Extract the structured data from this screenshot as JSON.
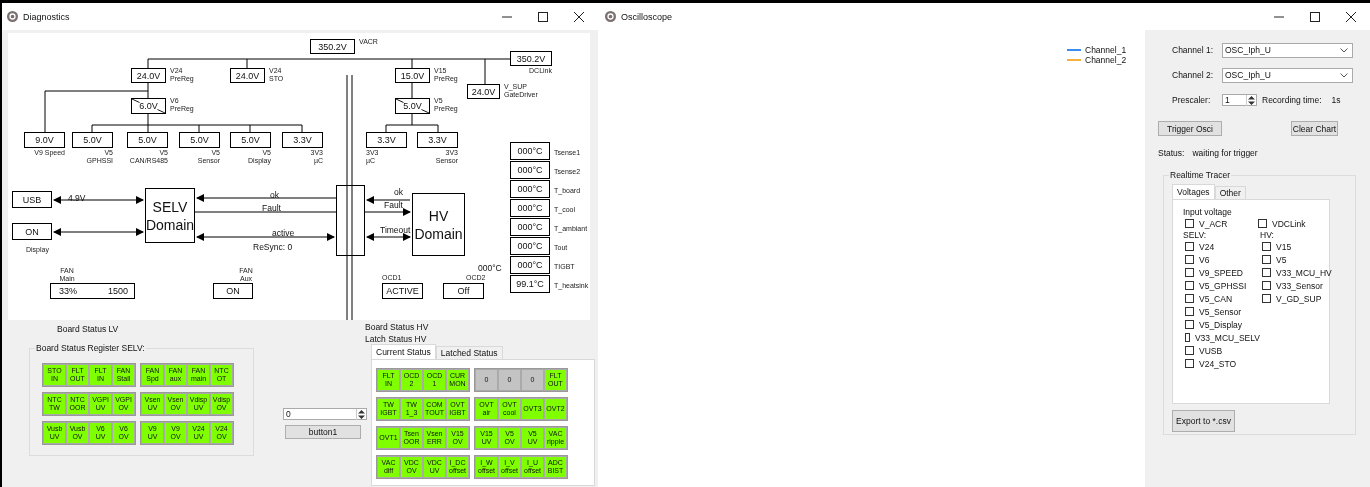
{
  "diagnostics": {
    "title": "Diagnostics",
    "diagram": {
      "voltages": [
        {
          "value": "350.2V",
          "label": "VACR",
          "kind": "reading"
        },
        {
          "value": "24.0V",
          "label": "V24\nPreReg",
          "kind": "reading"
        },
        {
          "value": "24.0V",
          "label": "V24\nSTO",
          "kind": "reading"
        },
        {
          "value": "6.0V",
          "label": "V6\nPreReg",
          "kind": "regulator"
        },
        {
          "value": "9.0V",
          "label": "V9 Speed",
          "kind": "reading"
        },
        {
          "value": "5.0V",
          "label": "V5\nGPHSSI",
          "kind": "reading"
        },
        {
          "value": "5.0V",
          "label": "V5\nCAN/RS485",
          "kind": "reading"
        },
        {
          "value": "5.0V",
          "label": "V5\nSensor",
          "kind": "reading"
        },
        {
          "value": "5.0V",
          "label": "V5\nDisplay",
          "kind": "reading"
        },
        {
          "value": "3.3V",
          "label": "3V3\nµC",
          "kind": "reading"
        },
        {
          "value": "15.0V",
          "label": "V15\nPreReg",
          "kind": "reading"
        },
        {
          "value": "5.0V",
          "label": "V5\nPreReg",
          "kind": "regulator"
        },
        {
          "value": "3.3V",
          "label": "3V3\nµC",
          "kind": "reading"
        },
        {
          "value": "3.3V",
          "label": "3V3\nSensor",
          "kind": "reading"
        },
        {
          "value": "350.2V",
          "label": "DCLink",
          "kind": "reading"
        },
        {
          "value": "24.0V",
          "label": "V_SUP\nGateDriver",
          "kind": "reading"
        }
      ],
      "temps": [
        {
          "value": "000°C",
          "label": "Tsense1"
        },
        {
          "value": "000°C",
          "label": "Tsense2"
        },
        {
          "value": "000°C",
          "label": "T_board"
        },
        {
          "value": "000°C",
          "label": "T_cool"
        },
        {
          "value": "000°C",
          "label": "T_ambiant"
        },
        {
          "value": "000°C",
          "label": "Tout"
        },
        {
          "value": "000°C",
          "label": "TIGBT"
        },
        {
          "value": "99.1°C",
          "label": "T_heatsink"
        }
      ],
      "usb": {
        "value": "USB",
        "reading": "4.9V"
      },
      "display": {
        "value": "ON",
        "label": "Display"
      },
      "selv_domain": "SELV\nDomain",
      "hv_domain": "HV\nDomain",
      "signals": [
        "ok",
        "Fault",
        "active",
        "ReSync: 0",
        "ok",
        "Fault",
        "Timeout"
      ],
      "fan_main": {
        "label": "FAN\nMain",
        "percent": "33%",
        "rpm": "1500"
      },
      "fan_aux": {
        "label": "FAN\nAux",
        "value": "ON"
      },
      "ocd1": {
        "label": "OCD1",
        "value": "ACTIVE"
      },
      "ocd2": {
        "label": "OCD2",
        "value": "Off"
      },
      "extra_temp": "000°C"
    },
    "board_status_lv": {
      "title": "Board Status LV",
      "group": "Board Status Register SELV:",
      "rows": [
        [
          [
            {
              "text": "STO\nIN",
              "on": true
            },
            {
              "text": "FLT\nOUT",
              "on": true
            },
            {
              "text": "FLT\nIN",
              "on": true
            },
            {
              "text": "FAN\nStall",
              "on": true
            }
          ],
          [
            {
              "text": "FAN\nSpd",
              "on": true
            },
            {
              "text": "FAN\naux",
              "on": true
            },
            {
              "text": "FAN\nmain",
              "on": true
            },
            {
              "text": "NTC\nOT",
              "on": true
            }
          ]
        ],
        [
          [
            {
              "text": "NTC\nTW",
              "on": true
            },
            {
              "text": "NTC\nOOR",
              "on": true
            },
            {
              "text": "VGPI\nUV",
              "on": true
            },
            {
              "text": "VGPI\nOV",
              "on": true
            }
          ],
          [
            {
              "text": "Vsen\nUV",
              "on": true
            },
            {
              "text": "Vsen\nOV",
              "on": true
            },
            {
              "text": "Vdisp\nUV",
              "on": true
            },
            {
              "text": "Vdisp\nOV",
              "on": true
            }
          ]
        ],
        [
          [
            {
              "text": "Vusb\nUV",
              "on": true
            },
            {
              "text": "Vusb\nOV",
              "on": true
            },
            {
              "text": "V6\nUV",
              "on": true
            },
            {
              "text": "V6\nOV",
              "on": true
            }
          ],
          [
            {
              "text": "V9\nUV",
              "on": true
            },
            {
              "text": "V9\nOV",
              "on": true
            },
            {
              "text": "V24\nUV",
              "on": true
            },
            {
              "text": "V24\nOV",
              "on": true
            }
          ]
        ]
      ]
    },
    "spinner": {
      "value": "0"
    },
    "button": "button1",
    "board_status_hv": {
      "title": "Board Status HV",
      "latch_title": "Latch Status HV",
      "tabs": [
        {
          "label": "Current Status",
          "selected": true
        },
        {
          "label": "Latched Status",
          "selected": false
        }
      ],
      "rows": [
        [
          [
            {
              "text": "FLT\nIN",
              "on": true
            },
            {
              "text": "OCD\n2",
              "on": true
            },
            {
              "text": "OCD\n1",
              "on": true
            },
            {
              "text": "CUR\nMON",
              "on": true
            }
          ],
          [
            {
              "text": "0",
              "on": false
            },
            {
              "text": "0",
              "on": false
            },
            {
              "text": "0",
              "on": false
            },
            {
              "text": "FLT\nOUT",
              "on": true
            }
          ]
        ],
        [
          [
            {
              "text": "TW\nIGBT",
              "on": true
            },
            {
              "text": "TW\n1_3",
              "on": true
            },
            {
              "text": "COM\nTOUT",
              "on": true
            },
            {
              "text": "OVT\nIGBT",
              "on": true
            }
          ],
          [
            {
              "text": "OVT\nair",
              "on": true
            },
            {
              "text": "OVT\ncool",
              "on": true
            },
            {
              "text": "OVT3",
              "on": true
            },
            {
              "text": "OVT2",
              "on": true
            }
          ]
        ],
        [
          [
            {
              "text": "OVT1",
              "on": true
            },
            {
              "text": "Tsen\nOOR",
              "on": true
            },
            {
              "text": "Vsen\nERR",
              "on": true
            },
            {
              "text": "V15\nOV",
              "on": true
            }
          ],
          [
            {
              "text": "V15\nUV",
              "on": true
            },
            {
              "text": "V5\nOV",
              "on": true
            },
            {
              "text": "V5\nUV",
              "on": true
            },
            {
              "text": "VAC\nripple",
              "on": true
            }
          ]
        ],
        [
          [
            {
              "text": "VAC\ndiff",
              "on": true
            },
            {
              "text": "VDC\nOV",
              "on": true
            },
            {
              "text": "VDC\nUV",
              "on": true
            },
            {
              "text": "I_DC\noffset",
              "on": true
            }
          ],
          [
            {
              "text": "I_W\noffset",
              "on": true
            },
            {
              "text": "I_V\noffset",
              "on": true
            },
            {
              "text": "I_U\noffset",
              "on": true
            },
            {
              "text": "ADC\nBIST",
              "on": true
            }
          ]
        ]
      ]
    }
  },
  "oscilloscope": {
    "title": "Oscilloscope",
    "legend": [
      {
        "name": "Channel_1",
        "color": "#3c8cf0"
      },
      {
        "name": "Channel_2",
        "color": "#f5b041"
      }
    ],
    "channel1": {
      "label": "Channel 1:",
      "value": "OSC_Iph_U"
    },
    "channel2": {
      "label": "Channel 2:",
      "value": "OSC_Iph_U"
    },
    "prescaler": {
      "label": "Prescaler:",
      "value": "1"
    },
    "recording_label": "Recording time:",
    "recording_value": "1s",
    "buttons": [
      "Trigger Osci",
      "Clear Chart"
    ],
    "status_label": "Status:",
    "status_value": "waiting for trigger",
    "tracer": {
      "title": "Realtime Tracer",
      "tabs": [
        {
          "label": "Voltages",
          "selected": true
        },
        {
          "label": "Other",
          "selected": false
        }
      ],
      "input_heading": "Input voltage",
      "input_items": [
        {
          "label": "V_ACR",
          "checked": false
        },
        {
          "label": "VDCLink",
          "checked": false
        }
      ],
      "selv_heading": "SELV:",
      "selv_items": [
        {
          "label": "V24",
          "checked": false
        },
        {
          "label": "V6",
          "checked": false
        },
        {
          "label": "V9_SPEED",
          "checked": false
        },
        {
          "label": "V5_GPHSSI",
          "checked": false
        },
        {
          "label": "V5_CAN",
          "checked": false
        },
        {
          "label": "V5_Sensor",
          "checked": false
        },
        {
          "label": "V5_Display",
          "checked": false
        },
        {
          "label": "V33_MCU_SELV",
          "checked": false
        },
        {
          "label": "VUSB",
          "checked": false
        },
        {
          "label": "V24_STO",
          "checked": false
        }
      ],
      "hv_heading": "HV:",
      "hv_items": [
        {
          "label": "V15",
          "checked": false
        },
        {
          "label": "V5",
          "checked": false
        },
        {
          "label": "V33_MCU_HV",
          "checked": false
        },
        {
          "label": "V33_Sensor",
          "checked": false
        },
        {
          "label": "V_GD_SUP",
          "checked": false
        }
      ],
      "export": "Export to *.csv"
    }
  }
}
